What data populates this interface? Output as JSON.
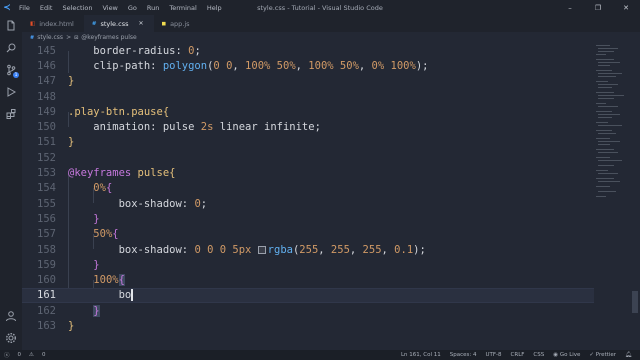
{
  "window": {
    "title": "style.css - Tutorial - Visual Studio Code",
    "menu": [
      "File",
      "Edit",
      "Selection",
      "View",
      "Go",
      "Run",
      "Terminal",
      "Help"
    ],
    "controls": [
      "–",
      "❐",
      "✕"
    ]
  },
  "activity_bar": {
    "icons": [
      "files-icon",
      "search-icon",
      "source-control-icon",
      "run-debug-icon",
      "extensions-icon"
    ],
    "badge": "1",
    "bottom_icons": [
      "account-icon",
      "settings-gear-icon"
    ]
  },
  "tabs": [
    {
      "icon": "HTML",
      "label": "index.html",
      "active": false
    },
    {
      "icon": "#",
      "label": "style.css",
      "active": true
    },
    {
      "icon": "JS",
      "label": "app.js",
      "active": false
    }
  ],
  "breadcrumb": {
    "file": "style.css",
    "separator": ">",
    "symbol": "@keyframes pulse"
  },
  "editor": {
    "line_numbers": [
      "145",
      "146",
      "147",
      "148",
      "149",
      "150",
      "151",
      "152",
      "153",
      "154",
      "155",
      "156",
      "157",
      "158",
      "159",
      "160",
      "161",
      "162",
      "163"
    ],
    "current_line": "161"
  },
  "status_bar": {
    "errors": "0",
    "warnings": "0",
    "cursor_position": "Ln 161, Col 11",
    "spaces": "Spaces: 4",
    "encoding": "UTF-8",
    "eol": "CRLF",
    "language": "CSS",
    "live": "Go Live",
    "prettier": "✓ Prettier"
  },
  "colors": {
    "background": "#232834",
    "selector": "#e5c07b",
    "number": "#d19a66",
    "function": "#61afef",
    "keyword": "#c678dd"
  }
}
